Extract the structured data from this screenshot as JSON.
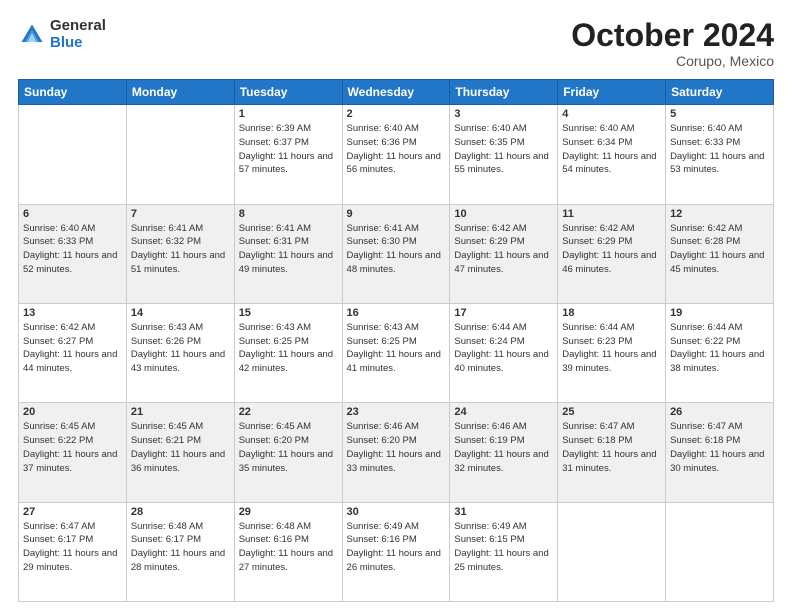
{
  "header": {
    "logo_general": "General",
    "logo_blue": "Blue",
    "month_title": "October 2024",
    "location": "Corupo, Mexico"
  },
  "weekdays": [
    "Sunday",
    "Monday",
    "Tuesday",
    "Wednesday",
    "Thursday",
    "Friday",
    "Saturday"
  ],
  "weeks": [
    [
      {
        "day": "",
        "sunrise": "",
        "sunset": "",
        "daylight": ""
      },
      {
        "day": "",
        "sunrise": "",
        "sunset": "",
        "daylight": ""
      },
      {
        "day": "1",
        "sunrise": "Sunrise: 6:39 AM",
        "sunset": "Sunset: 6:37 PM",
        "daylight": "Daylight: 11 hours and 57 minutes."
      },
      {
        "day": "2",
        "sunrise": "Sunrise: 6:40 AM",
        "sunset": "Sunset: 6:36 PM",
        "daylight": "Daylight: 11 hours and 56 minutes."
      },
      {
        "day": "3",
        "sunrise": "Sunrise: 6:40 AM",
        "sunset": "Sunset: 6:35 PM",
        "daylight": "Daylight: 11 hours and 55 minutes."
      },
      {
        "day": "4",
        "sunrise": "Sunrise: 6:40 AM",
        "sunset": "Sunset: 6:34 PM",
        "daylight": "Daylight: 11 hours and 54 minutes."
      },
      {
        "day": "5",
        "sunrise": "Sunrise: 6:40 AM",
        "sunset": "Sunset: 6:33 PM",
        "daylight": "Daylight: 11 hours and 53 minutes."
      }
    ],
    [
      {
        "day": "6",
        "sunrise": "Sunrise: 6:40 AM",
        "sunset": "Sunset: 6:33 PM",
        "daylight": "Daylight: 11 hours and 52 minutes."
      },
      {
        "day": "7",
        "sunrise": "Sunrise: 6:41 AM",
        "sunset": "Sunset: 6:32 PM",
        "daylight": "Daylight: 11 hours and 51 minutes."
      },
      {
        "day": "8",
        "sunrise": "Sunrise: 6:41 AM",
        "sunset": "Sunset: 6:31 PM",
        "daylight": "Daylight: 11 hours and 49 minutes."
      },
      {
        "day": "9",
        "sunrise": "Sunrise: 6:41 AM",
        "sunset": "Sunset: 6:30 PM",
        "daylight": "Daylight: 11 hours and 48 minutes."
      },
      {
        "day": "10",
        "sunrise": "Sunrise: 6:42 AM",
        "sunset": "Sunset: 6:29 PM",
        "daylight": "Daylight: 11 hours and 47 minutes."
      },
      {
        "day": "11",
        "sunrise": "Sunrise: 6:42 AM",
        "sunset": "Sunset: 6:29 PM",
        "daylight": "Daylight: 11 hours and 46 minutes."
      },
      {
        "day": "12",
        "sunrise": "Sunrise: 6:42 AM",
        "sunset": "Sunset: 6:28 PM",
        "daylight": "Daylight: 11 hours and 45 minutes."
      }
    ],
    [
      {
        "day": "13",
        "sunrise": "Sunrise: 6:42 AM",
        "sunset": "Sunset: 6:27 PM",
        "daylight": "Daylight: 11 hours and 44 minutes."
      },
      {
        "day": "14",
        "sunrise": "Sunrise: 6:43 AM",
        "sunset": "Sunset: 6:26 PM",
        "daylight": "Daylight: 11 hours and 43 minutes."
      },
      {
        "day": "15",
        "sunrise": "Sunrise: 6:43 AM",
        "sunset": "Sunset: 6:25 PM",
        "daylight": "Daylight: 11 hours and 42 minutes."
      },
      {
        "day": "16",
        "sunrise": "Sunrise: 6:43 AM",
        "sunset": "Sunset: 6:25 PM",
        "daylight": "Daylight: 11 hours and 41 minutes."
      },
      {
        "day": "17",
        "sunrise": "Sunrise: 6:44 AM",
        "sunset": "Sunset: 6:24 PM",
        "daylight": "Daylight: 11 hours and 40 minutes."
      },
      {
        "day": "18",
        "sunrise": "Sunrise: 6:44 AM",
        "sunset": "Sunset: 6:23 PM",
        "daylight": "Daylight: 11 hours and 39 minutes."
      },
      {
        "day": "19",
        "sunrise": "Sunrise: 6:44 AM",
        "sunset": "Sunset: 6:22 PM",
        "daylight": "Daylight: 11 hours and 38 minutes."
      }
    ],
    [
      {
        "day": "20",
        "sunrise": "Sunrise: 6:45 AM",
        "sunset": "Sunset: 6:22 PM",
        "daylight": "Daylight: 11 hours and 37 minutes."
      },
      {
        "day": "21",
        "sunrise": "Sunrise: 6:45 AM",
        "sunset": "Sunset: 6:21 PM",
        "daylight": "Daylight: 11 hours and 36 minutes."
      },
      {
        "day": "22",
        "sunrise": "Sunrise: 6:45 AM",
        "sunset": "Sunset: 6:20 PM",
        "daylight": "Daylight: 11 hours and 35 minutes."
      },
      {
        "day": "23",
        "sunrise": "Sunrise: 6:46 AM",
        "sunset": "Sunset: 6:20 PM",
        "daylight": "Daylight: 11 hours and 33 minutes."
      },
      {
        "day": "24",
        "sunrise": "Sunrise: 6:46 AM",
        "sunset": "Sunset: 6:19 PM",
        "daylight": "Daylight: 11 hours and 32 minutes."
      },
      {
        "day": "25",
        "sunrise": "Sunrise: 6:47 AM",
        "sunset": "Sunset: 6:18 PM",
        "daylight": "Daylight: 11 hours and 31 minutes."
      },
      {
        "day": "26",
        "sunrise": "Sunrise: 6:47 AM",
        "sunset": "Sunset: 6:18 PM",
        "daylight": "Daylight: 11 hours and 30 minutes."
      }
    ],
    [
      {
        "day": "27",
        "sunrise": "Sunrise: 6:47 AM",
        "sunset": "Sunset: 6:17 PM",
        "daylight": "Daylight: 11 hours and 29 minutes."
      },
      {
        "day": "28",
        "sunrise": "Sunrise: 6:48 AM",
        "sunset": "Sunset: 6:17 PM",
        "daylight": "Daylight: 11 hours and 28 minutes."
      },
      {
        "day": "29",
        "sunrise": "Sunrise: 6:48 AM",
        "sunset": "Sunset: 6:16 PM",
        "daylight": "Daylight: 11 hours and 27 minutes."
      },
      {
        "day": "30",
        "sunrise": "Sunrise: 6:49 AM",
        "sunset": "Sunset: 6:16 PM",
        "daylight": "Daylight: 11 hours and 26 minutes."
      },
      {
        "day": "31",
        "sunrise": "Sunrise: 6:49 AM",
        "sunset": "Sunset: 6:15 PM",
        "daylight": "Daylight: 11 hours and 25 minutes."
      },
      {
        "day": "",
        "sunrise": "",
        "sunset": "",
        "daylight": ""
      },
      {
        "day": "",
        "sunrise": "",
        "sunset": "",
        "daylight": ""
      }
    ]
  ]
}
